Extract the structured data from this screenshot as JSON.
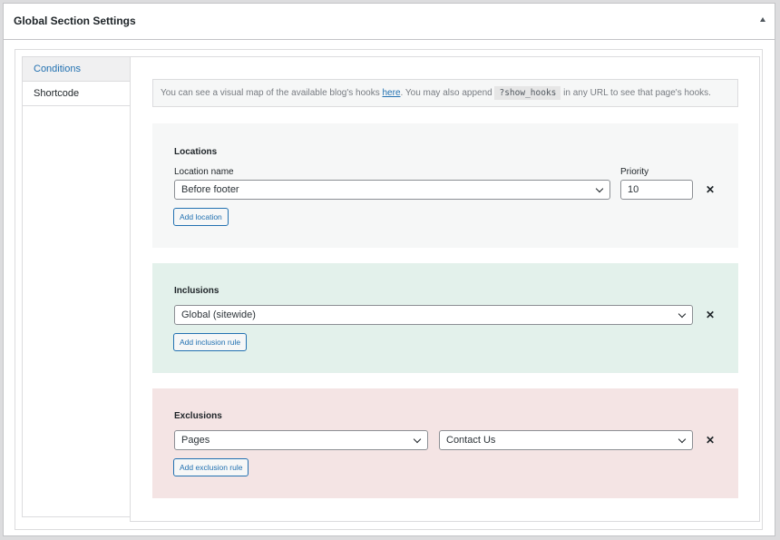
{
  "panel": {
    "title": "Global Section Settings",
    "toggle_icon": "arrow-up-icon"
  },
  "tabs": [
    {
      "label": "Conditions",
      "active": true
    },
    {
      "label": "Shortcode",
      "active": false
    }
  ],
  "notice": {
    "text_before": "You can see a visual map of the available blog's hooks ",
    "link_text": "here",
    "text_middle": ". You may also append ",
    "code": "?show_hooks",
    "text_after": " in any URL to see that page's hooks."
  },
  "locations": {
    "title": "Locations",
    "location_name_label": "Location name",
    "location_name_value": "Before footer",
    "priority_label": "Priority",
    "priority_value": "10",
    "remove_glyph": "✕",
    "add_button": "Add location"
  },
  "inclusions": {
    "title": "Inclusions",
    "rule_value": "Global (sitewide)",
    "remove_glyph": "✕",
    "add_button": "Add inclusion rule"
  },
  "exclusions": {
    "title": "Exclusions",
    "type_value": "Pages",
    "page_value": "Contact Us",
    "remove_glyph": "✕",
    "add_button": "Add exclusion rule"
  },
  "colors": {
    "accent": "#2271b1",
    "locations_bg": "#f6f7f7",
    "inclusions_bg": "#e3f1eb",
    "exclusions_bg": "#f4e4e4"
  }
}
